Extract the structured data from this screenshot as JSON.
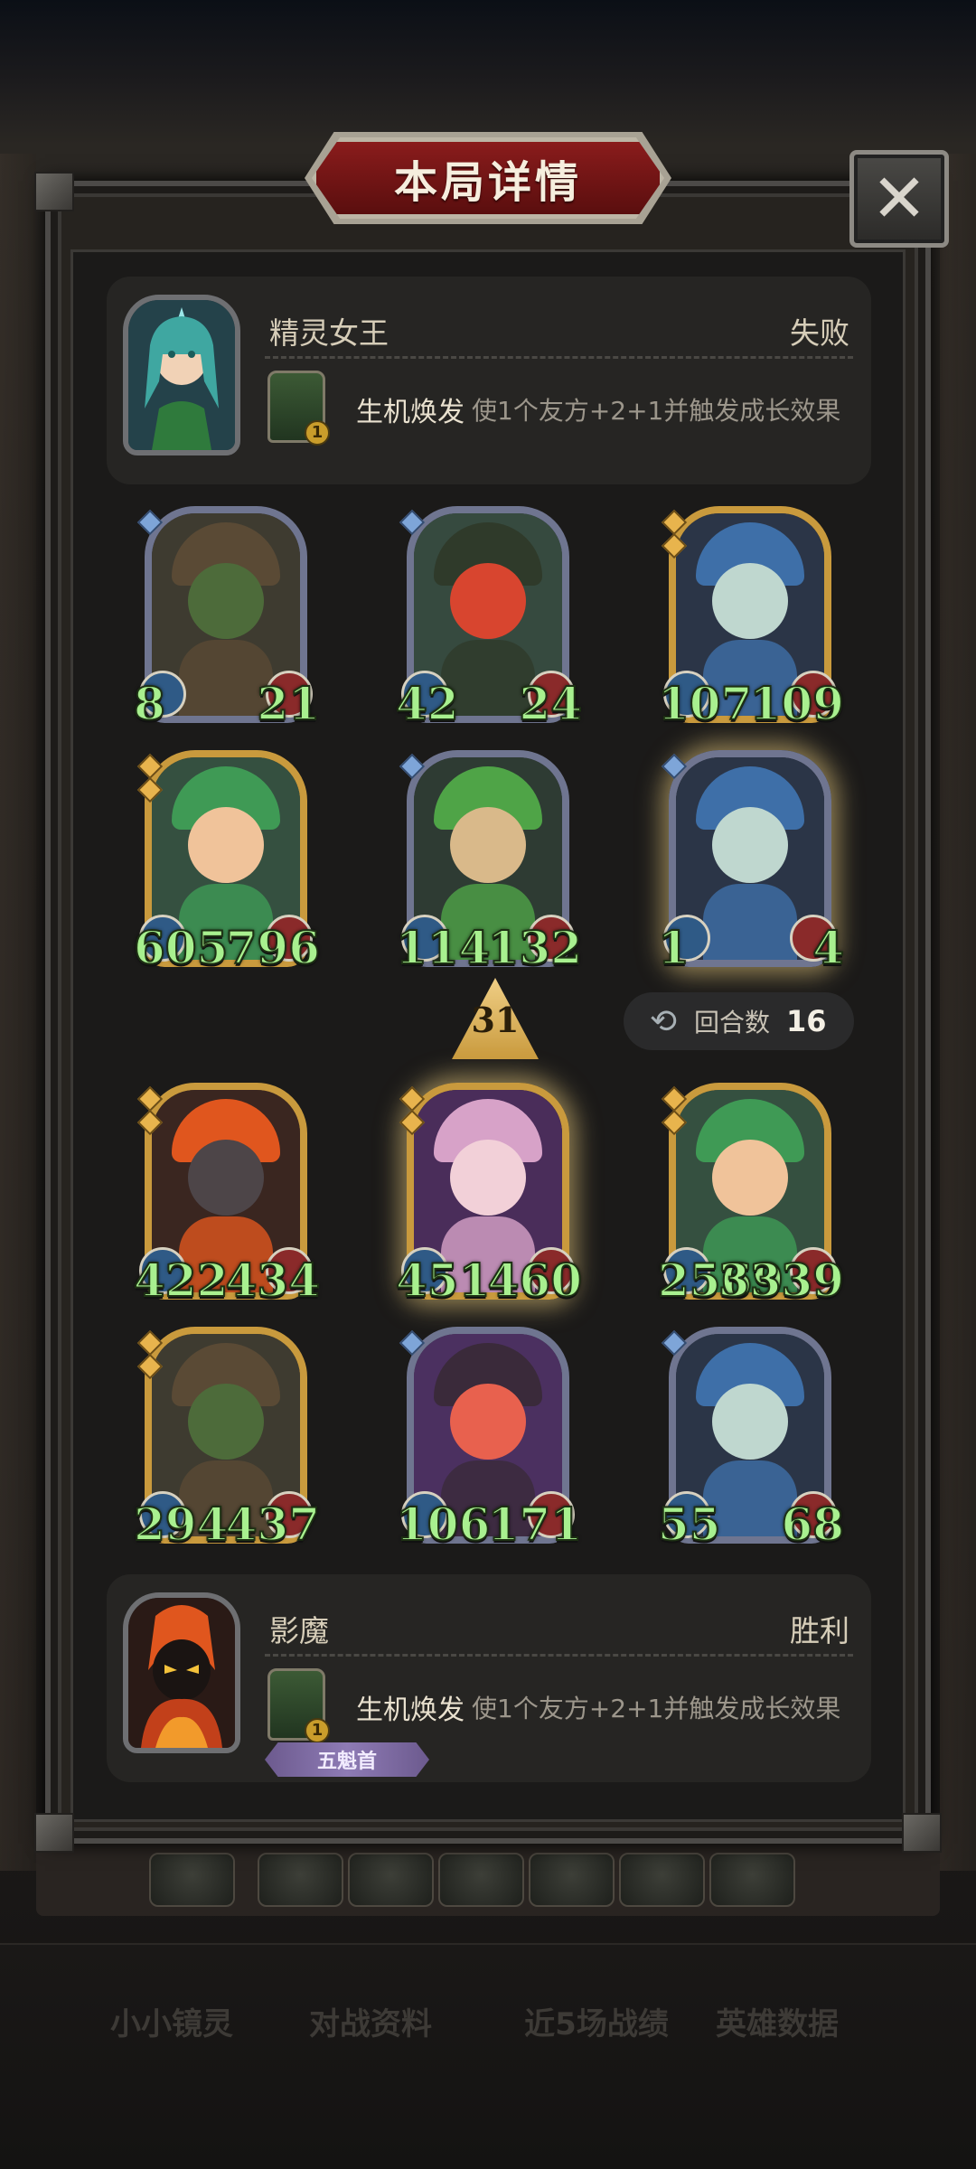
{
  "dialog": {
    "title": "本局详情",
    "close_label": "✕"
  },
  "top_player": {
    "name": "精灵女王",
    "result": "失败",
    "skill_name": "生机焕发",
    "skill_desc": "使1个友方+2+1并触发成长效果",
    "skill_level": "1"
  },
  "bottom_player": {
    "name": "影魔",
    "result": "胜利",
    "skill_name": "生机焕发",
    "skill_desc": "使1个友方+2+1并触发成长效果",
    "skill_level": "1",
    "rank_badge": "五魁首"
  },
  "top_units": [
    {
      "atk": "8",
      "hp": "21",
      "frame": "silver",
      "art": "goblin"
    },
    {
      "atk": "42",
      "hp": "24",
      "frame": "silver",
      "art": "tomato"
    },
    {
      "atk": "107",
      "hp": "109",
      "frame": "gold",
      "art": "elf"
    },
    {
      "atk": "605",
      "hp": "796",
      "frame": "gold",
      "art": "fairy"
    },
    {
      "atk": "114",
      "hp": "132",
      "frame": "silver",
      "art": "sprout"
    },
    {
      "atk": "1",
      "hp": "4",
      "frame": "silver",
      "art": "elf"
    }
  ],
  "bottom_units": [
    {
      "atk": "422",
      "hp": "434",
      "frame": "gold",
      "art": "demon"
    },
    {
      "atk": "451",
      "hp": "460",
      "frame": "gold",
      "art": "princess"
    },
    {
      "atk": "2569",
      "hp": "3339",
      "frame": "gold",
      "art": "fairy"
    },
    {
      "atk": "294",
      "hp": "437",
      "frame": "gold",
      "art": "goblin"
    },
    {
      "atk": "106",
      "hp": "171",
      "frame": "silver",
      "art": "blob"
    },
    {
      "atk": "55",
      "hp": "68",
      "frame": "silver",
      "art": "elf"
    }
  ],
  "turn": {
    "arrow_value": "31",
    "round_label": "回合数",
    "round_value": "16",
    "round_icon": "refresh-icon"
  },
  "bottom_tabs": [
    "小小镜灵",
    "对战资料",
    "近5场战绩",
    "英雄数据"
  ],
  "colors": {
    "stat_green": "#a8f08f",
    "banner_red": "#8a1c1c",
    "gold_frame": "#c99a3d",
    "silver_frame": "#6f7590"
  }
}
